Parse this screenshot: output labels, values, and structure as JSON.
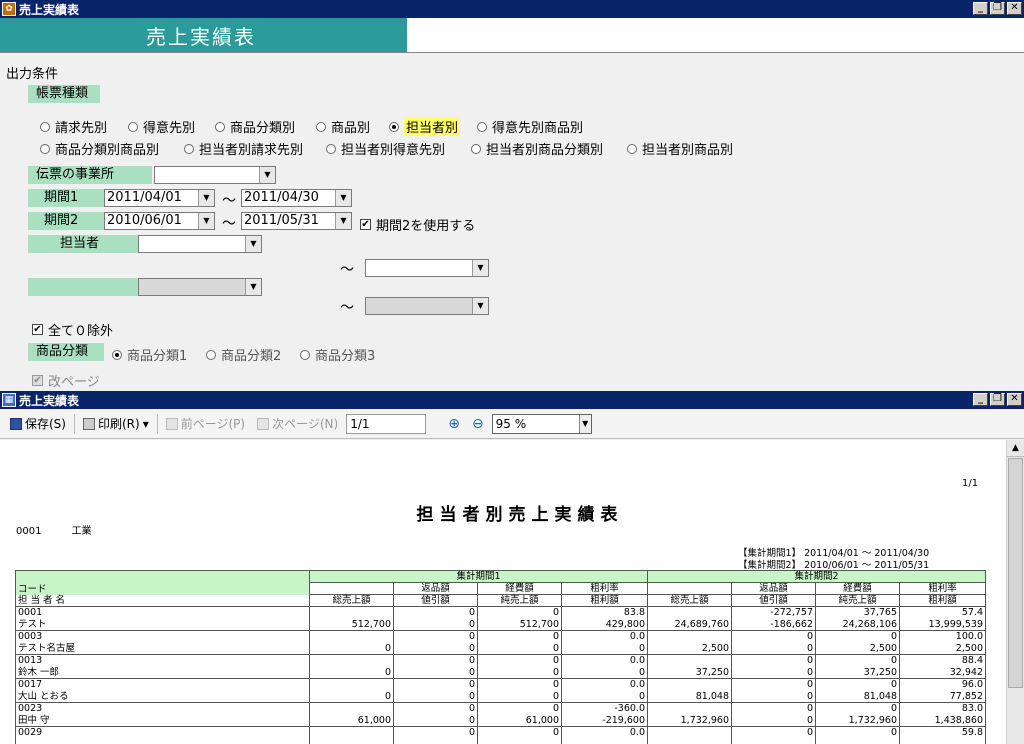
{
  "window1": {
    "title": "売上実績表"
  },
  "banner": {
    "title": "売上実績表"
  },
  "form": {
    "output_conditions": "出力条件",
    "report_type_label": "帳票種類",
    "report_types_row1": [
      {
        "label": "請求先別",
        "selected": false
      },
      {
        "label": "得意先別",
        "selected": false
      },
      {
        "label": "商品分類別",
        "selected": false
      },
      {
        "label": "商品別",
        "selected": false
      },
      {
        "label": "担当者別",
        "selected": true
      },
      {
        "label": "得意先別商品別",
        "selected": false
      }
    ],
    "report_types_row2": [
      {
        "label": "商品分類別商品別",
        "selected": false
      },
      {
        "label": "担当者別請求先別",
        "selected": false
      },
      {
        "label": "担当者別得意先別",
        "selected": false
      },
      {
        "label": "担当者別商品分類別",
        "selected": false
      },
      {
        "label": "担当者別商品別",
        "selected": false
      }
    ],
    "office_label": "伝票の事業所",
    "office_value": "",
    "period1_label": "期間1",
    "period1_from": "2011/04/01",
    "period1_to": "2011/04/30",
    "period2_label": "期間2",
    "period2_from": "2010/06/01",
    "period2_to": "2011/05/31",
    "use_period2_label": "期間2を使用する",
    "use_period2_checked": "✔",
    "tilde": "～",
    "person_label": "担当者",
    "person_from": "",
    "person_to": "",
    "blank_label": "",
    "exclude_zero_label": "全て０除外",
    "exclude_zero_checked": "✔",
    "category_label": "商品分類",
    "categories": [
      {
        "label": "商品分類1",
        "selected": true
      },
      {
        "label": "商品分類2",
        "selected": false
      },
      {
        "label": "商品分類3",
        "selected": false
      }
    ],
    "page_break_label": "改ページ",
    "page_break_checked": "✔"
  },
  "window2": {
    "title": "売上実績表"
  },
  "toolbar": {
    "save": "保存(S)",
    "print": "印刷(R)",
    "dropdown": "▾",
    "prev": "前ページ(P)",
    "next": "次ページ(N)",
    "page": "1/1",
    "zoom": "95 %"
  },
  "report": {
    "page_number": "1/1",
    "title": "担当者別売上実績表",
    "company_code": "0001",
    "company_name": "工業",
    "period1_text": "【集計期間1】 2011/04/01 ～ 2011/04/30",
    "period2_text": "【集計期間2】 2010/06/01 ～ 2011/05/31",
    "header": {
      "code": "コード",
      "name": "担 当 者 名",
      "p1": "集計期間1",
      "p2": "集計期間2",
      "returns": "返品額",
      "expenses": "経費額",
      "gross_rate": "粗利率",
      "total_sales": "総売上額",
      "discount": "値引額",
      "net_sales": "純売上額",
      "gross_profit": "粗利額"
    },
    "rows": [
      {
        "code": "0001",
        "name": "テスト",
        "a": [
          "",
          "0",
          "0",
          "83.8"
        ],
        "b": [
          "512,700",
          "0",
          "512,700",
          "429,800"
        ],
        "c": [
          "",
          "-272,757",
          "37,765",
          "57.4"
        ],
        "d": [
          "24,689,760",
          "-186,662",
          "24,268,106",
          "13,999,539"
        ]
      },
      {
        "code": "0003",
        "name": "テスト名古屋",
        "a": [
          "",
          "0",
          "0",
          "0.0"
        ],
        "b": [
          "0",
          "0",
          "0",
          "0"
        ],
        "c": [
          "",
          "0",
          "0",
          "100.0"
        ],
        "d": [
          "2,500",
          "0",
          "2,500",
          "2,500"
        ]
      },
      {
        "code": "0013",
        "name": "鈴木 一郎",
        "a": [
          "",
          "0",
          "0",
          "0.0"
        ],
        "b": [
          "0",
          "0",
          "0",
          "0"
        ],
        "c": [
          "",
          "0",
          "0",
          "88.4"
        ],
        "d": [
          "37,250",
          "0",
          "37,250",
          "32,942"
        ]
      },
      {
        "code": "0017",
        "name": "大山 とおる",
        "a": [
          "",
          "0",
          "0",
          "0.0"
        ],
        "b": [
          "0",
          "0",
          "0",
          "0"
        ],
        "c": [
          "",
          "0",
          "0",
          "96.0"
        ],
        "d": [
          "81,048",
          "0",
          "81,048",
          "77,852"
        ]
      },
      {
        "code": "0023",
        "name": "田中 守",
        "a": [
          "",
          "0",
          "0",
          "-360.0"
        ],
        "b": [
          "61,000",
          "0",
          "61,000",
          "-219,600"
        ],
        "c": [
          "",
          "0",
          "0",
          "83.0"
        ],
        "d": [
          "1,732,960",
          "0",
          "1,732,960",
          "1,438,860"
        ]
      },
      {
        "code": "0029",
        "name": "",
        "a": [
          "",
          "0",
          "0",
          "0.0"
        ],
        "b": [
          "",
          "",
          "",
          ""
        ],
        "c": [
          "",
          "0",
          "0",
          "59.8"
        ],
        "d": [
          "",
          "",
          "",
          ""
        ]
      }
    ]
  }
}
